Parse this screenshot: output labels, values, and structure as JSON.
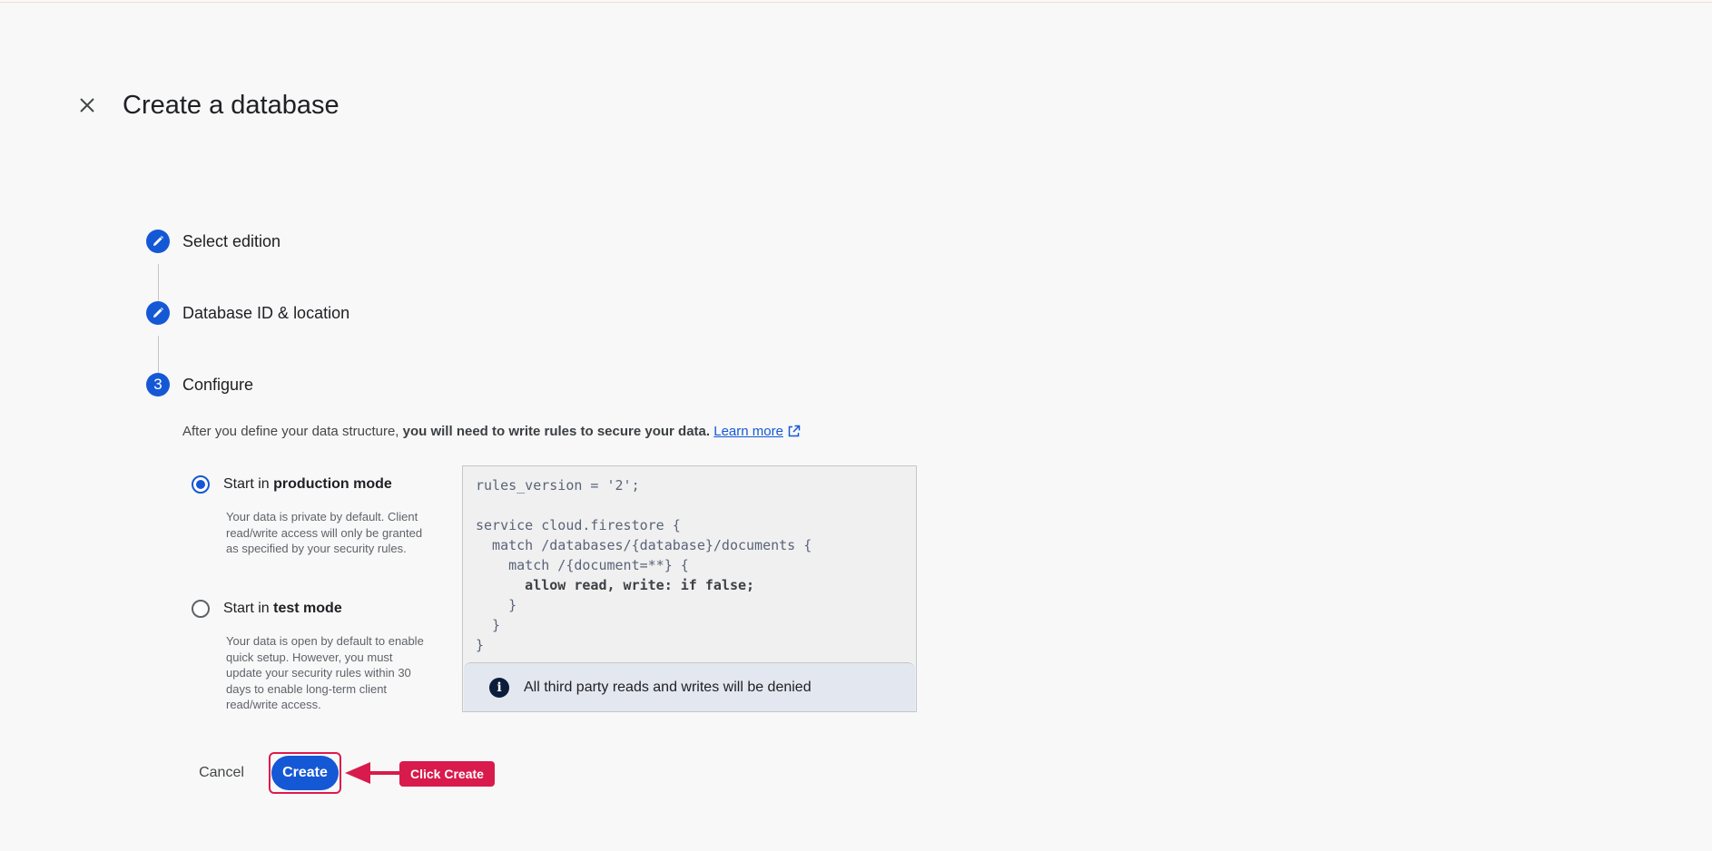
{
  "header": {
    "title": "Create a database",
    "close_icon": "close-icon"
  },
  "steps": [
    {
      "label": "Select edition",
      "icon": "pencil-icon",
      "state": "completed"
    },
    {
      "label": "Database ID & location",
      "icon": "pencil-icon",
      "state": "completed"
    },
    {
      "label": "Configure",
      "number": "3",
      "state": "active"
    }
  ],
  "configure": {
    "intro_text": "After you define your data structure, ",
    "intro_bold": "you will need to write rules to secure your data.",
    "learn_more": "Learn more",
    "options": [
      {
        "label_prefix": "Start in ",
        "label_bold": "production mode",
        "checked": true,
        "description": "Your data is private by default. Client read/write access will only be granted as specified by your security rules."
      },
      {
        "label_prefix": "Start in ",
        "label_bold": "test mode",
        "checked": false,
        "description": "Your data is open by default to enable quick setup. However, you must update your security rules within 30 days to enable long-term client read/write access."
      }
    ],
    "rules_code": {
      "line1": "rules_version = '2';",
      "line2": "",
      "line3": "service cloud.firestore {",
      "line4": "  match /databases/{database}/documents {",
      "line5": "    match /{document=**} {",
      "line6": "      allow read, write: if false;",
      "line7": "    }",
      "line8": "  }",
      "line9": "}"
    },
    "banner_text": "All third party reads and writes will be denied"
  },
  "footer": {
    "cancel_label": "Cancel",
    "create_label": "Create"
  },
  "annotation": {
    "callout_text": "Click Create"
  },
  "colors": {
    "accent": "#1558d6",
    "callout": "#d81b4c"
  }
}
